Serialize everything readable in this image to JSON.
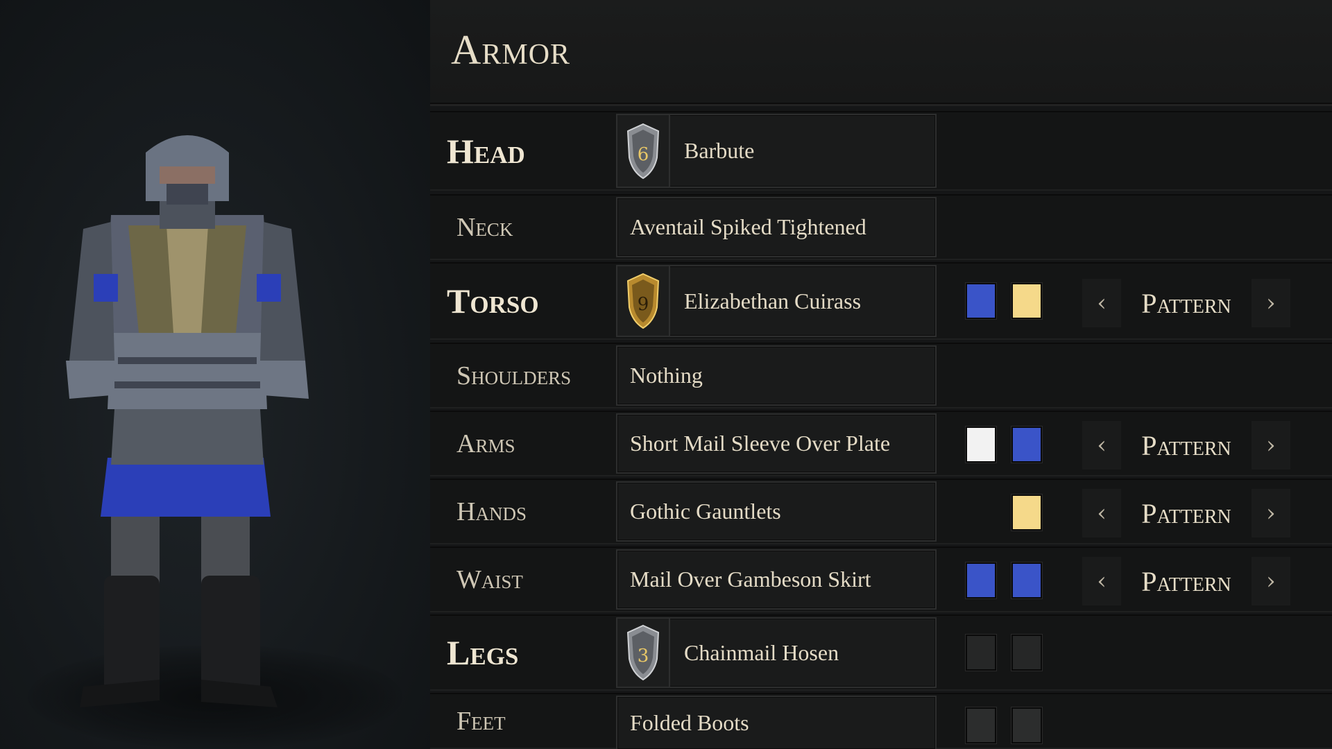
{
  "panel": {
    "title": "Armor"
  },
  "colors": {
    "blue": "#3a54c8",
    "gold": "#f5d98a",
    "white": "#f2f2f2",
    "empty": "#262727"
  },
  "slots": {
    "head": {
      "label": "Head",
      "item": "Barbute",
      "badge": "6",
      "badge_color": "silver"
    },
    "neck": {
      "label": "Neck",
      "item": "Aventail Spiked Tightened"
    },
    "torso": {
      "label": "Torso",
      "item": "Elizabethan Cuirass",
      "badge": "9",
      "badge_color": "gold",
      "colors": [
        "#3a54c8",
        "#f5d98a"
      ],
      "pattern": "Pattern"
    },
    "shoulders": {
      "label": "Shoulders",
      "item": "Nothing"
    },
    "arms": {
      "label": "Arms",
      "item": "Short Mail Sleeve Over Plate",
      "colors": [
        "#f2f2f2",
        "#3a54c8"
      ],
      "pattern": "Pattern"
    },
    "hands": {
      "label": "Hands",
      "item": "Gothic Gauntlets",
      "colors": [
        "#f5d98a"
      ],
      "pattern": "Pattern"
    },
    "waist": {
      "label": "Waist",
      "item": "Mail Over Gambeson Skirt",
      "colors": [
        "#3a54c8",
        "#3a54c8"
      ],
      "pattern": "Pattern"
    },
    "legs": {
      "label": "Legs",
      "item": "Chainmail Hosen",
      "badge": "3",
      "badge_color": "silver",
      "colors": [
        "#262727",
        "#262727"
      ]
    },
    "feet": {
      "label": "Feet",
      "item": "Folded Boots",
      "colors": [
        "#2c2d2d",
        "#2c2d2d"
      ]
    }
  },
  "pattern_controls": {
    "prev_icon": "chevron-left-icon",
    "next_icon": "chevron-right-icon"
  }
}
